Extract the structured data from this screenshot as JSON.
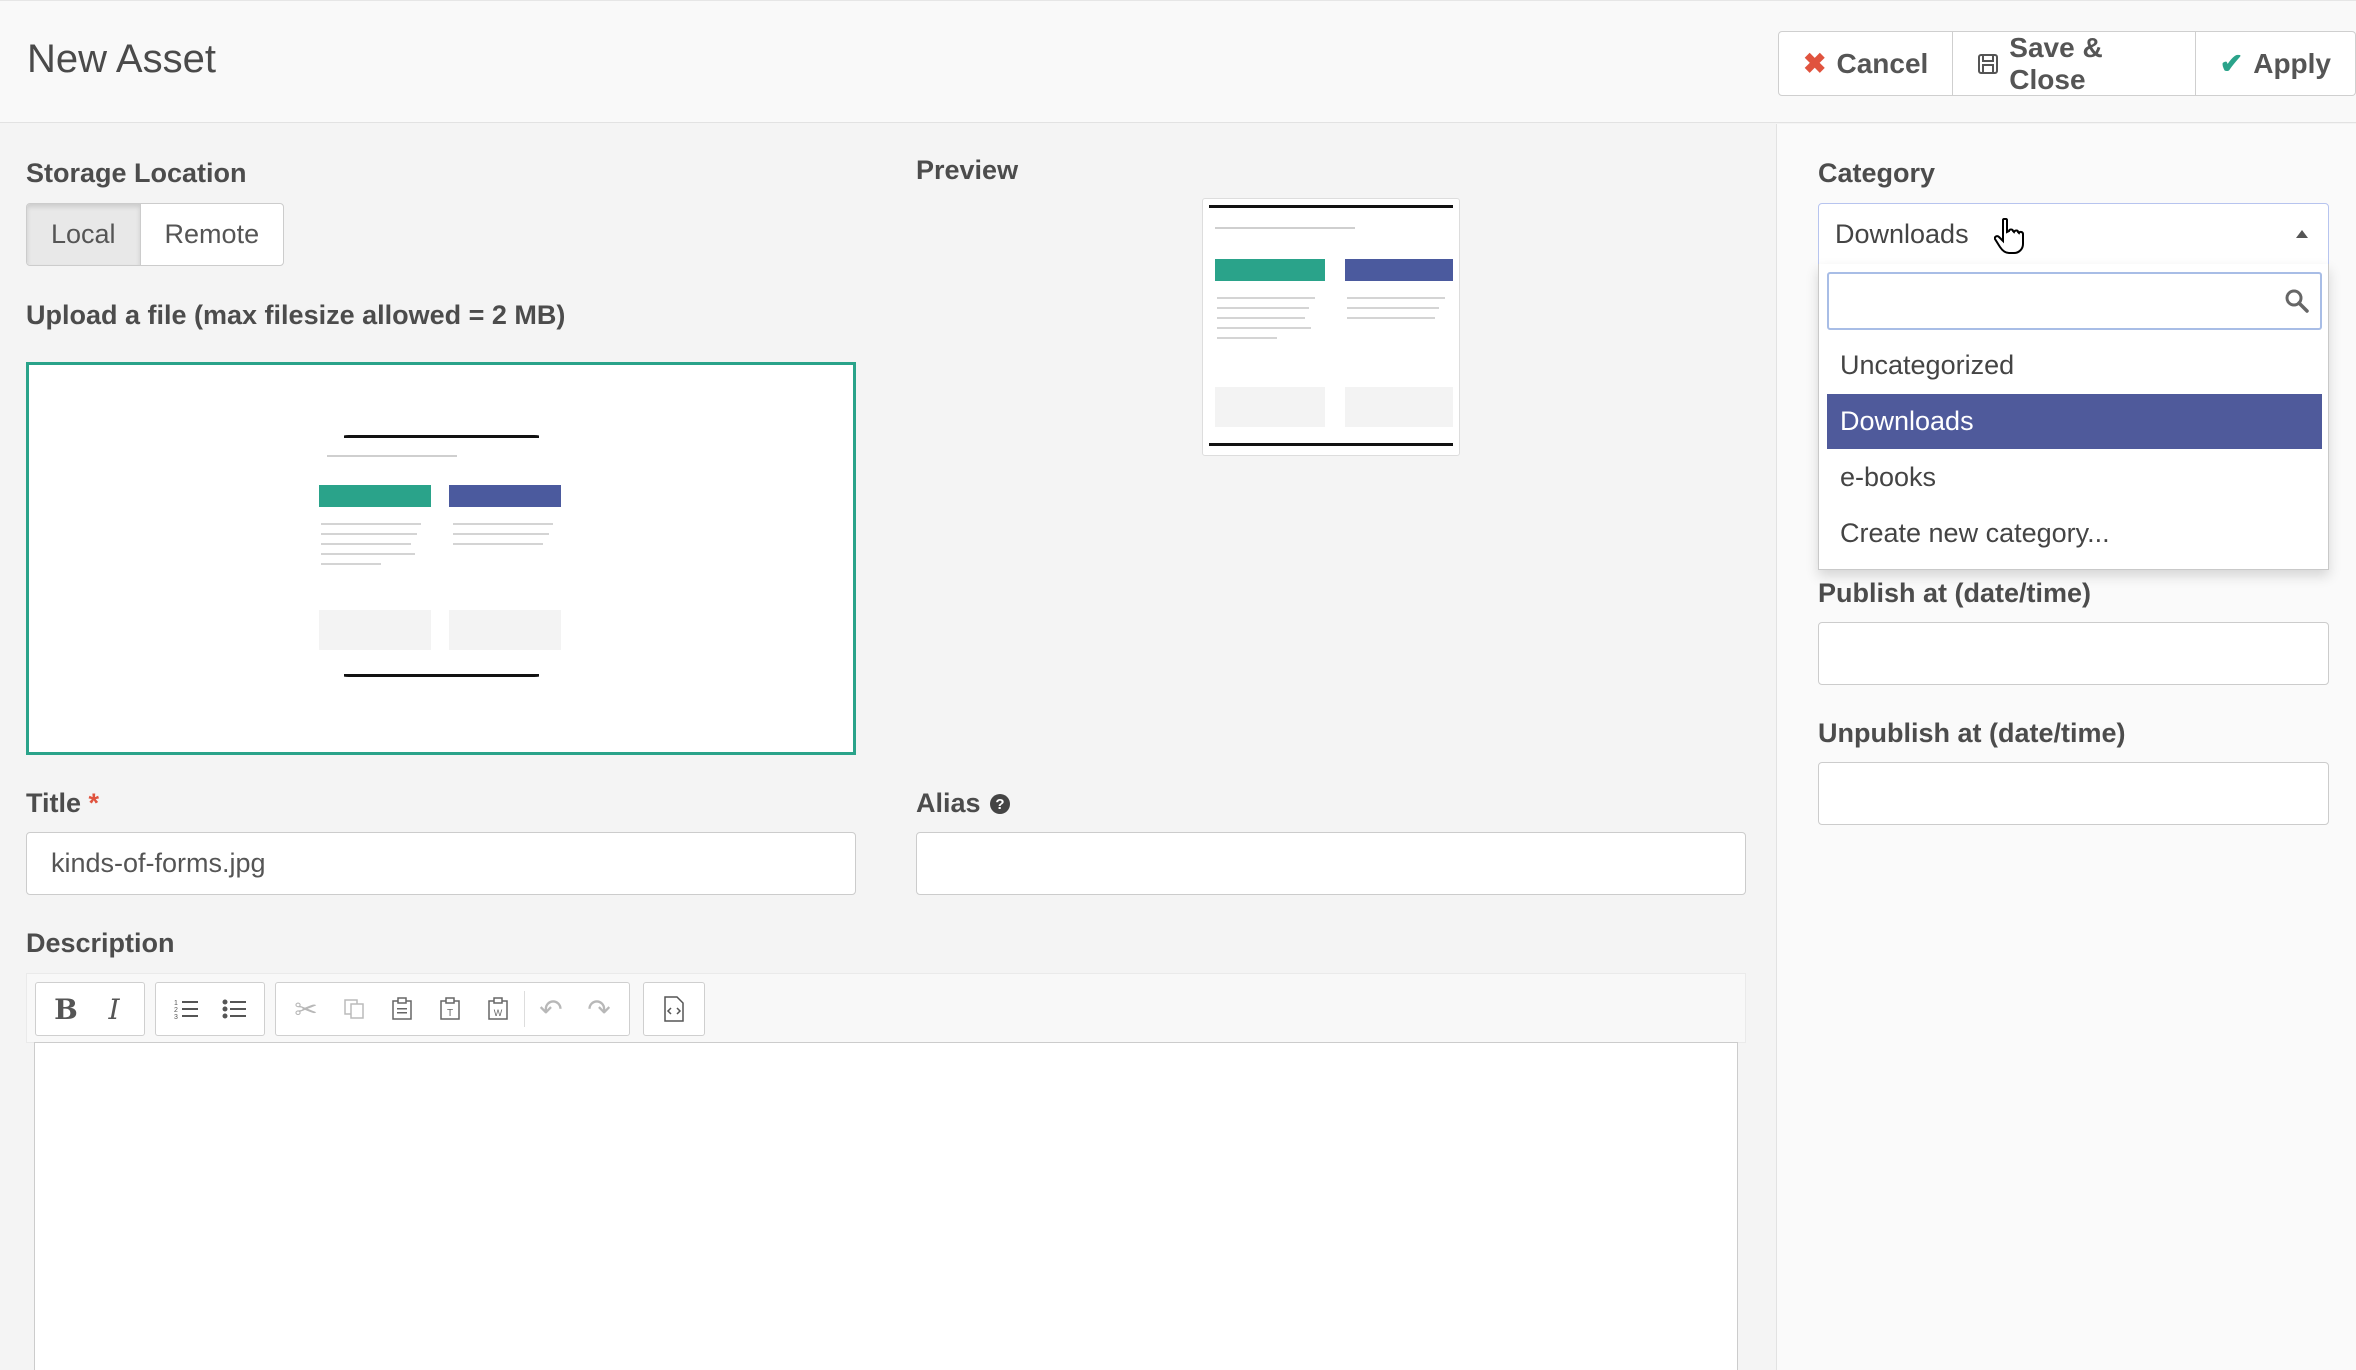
{
  "header": {
    "title": "New Asset",
    "buttons": {
      "cancel": "Cancel",
      "save_close": "Save & Close",
      "apply": "Apply"
    }
  },
  "storage": {
    "label": "Storage Location",
    "options": [
      "Local",
      "Remote"
    ],
    "selected": "Local"
  },
  "upload": {
    "label": "Upload a file (max filesize allowed = 2 MB)"
  },
  "preview": {
    "label": "Preview"
  },
  "title_field": {
    "label": "Title",
    "required_mark": "*",
    "value": "kinds-of-forms.jpg"
  },
  "alias_field": {
    "label": "Alias",
    "value": ""
  },
  "description": {
    "label": "Description",
    "toolbar_icons": [
      "bold-icon",
      "italic-icon",
      "numbered-list-icon",
      "bulleted-list-icon",
      "cut-icon",
      "copy-icon",
      "paste-icon",
      "paste-text-icon",
      "paste-word-icon",
      "undo-icon",
      "redo-icon",
      "source-icon"
    ]
  },
  "category": {
    "label": "Category",
    "selected": "Downloads",
    "search_value": "",
    "options": [
      "Uncategorized",
      "Downloads",
      "e-books",
      "Create new category..."
    ]
  },
  "publish_at": {
    "label": "Publish at (date/time)",
    "value": ""
  },
  "unpublish_at": {
    "label": "Unpublish at (date/time)",
    "value": ""
  },
  "colors": {
    "accent_teal": "#2aa38a",
    "danger_red": "#e0533e",
    "selected_option": "#4f5a9b",
    "card_blue": "#4b5a9e"
  }
}
